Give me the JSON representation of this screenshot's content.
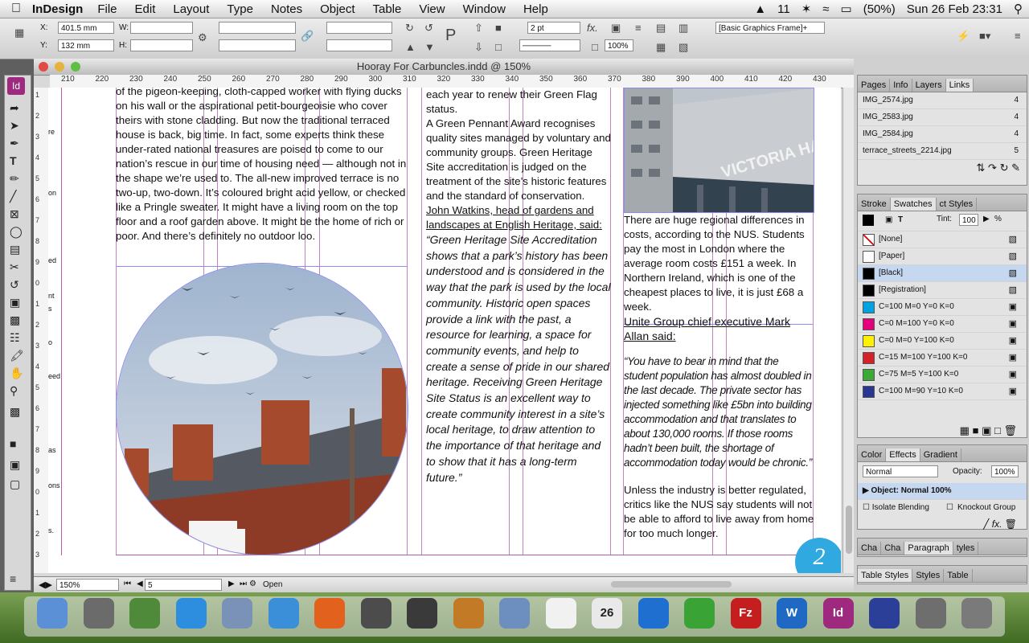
{
  "menubar": {
    "app_name": "InDesign",
    "items": [
      "File",
      "Edit",
      "Layout",
      "Type",
      "Notes",
      "Object",
      "Table",
      "View",
      "Window",
      "Help"
    ],
    "status": {
      "adobe_count": "11",
      "battery": "(50%)",
      "datetime": "Sun 26 Feb  23:31"
    }
  },
  "control": {
    "x_label": "X:",
    "x_value": "401.5 mm",
    "y_label": "Y:",
    "y_value": "132 mm",
    "w_label": "W:",
    "h_label": "H:",
    "stroke_weight": "2 pt",
    "zoom_pct": "100%",
    "object_style": "[Basic Graphics Frame]+"
  },
  "document": {
    "title": "Hooray For Carbuncles.indd @ 150%",
    "ruler_h": [
      "210",
      "220",
      "230",
      "240",
      "250",
      "260",
      "270",
      "280",
      "290",
      "300",
      "310",
      "320",
      "330",
      "340",
      "350",
      "360",
      "370",
      "380",
      "390",
      "400",
      "410",
      "420",
      "430"
    ],
    "ruler_v": [
      "1",
      "2",
      "3",
      "4",
      "5",
      "6",
      "7",
      "8",
      "9",
      "0",
      "1",
      "2",
      "3",
      "4",
      "5",
      "6",
      "7",
      "8",
      "9",
      "0",
      "1",
      "2",
      "3"
    ],
    "page_number_corner": "2",
    "col1_text": "of the pigeon-keeping, cloth-capped worker with flying ducks on his wall or the aspirational petit-bourgeoisie who cover theirs with stone cladding. But now the traditional terraced house is back, big time. In fact, some experts think these under-rated national treasures are poised to come to our nation’s rescue in our time of housing need — although not in the shape we’re used to. The all-new improved terrace is no two-up, two-down. It’s coloured bright acid yellow, or checked like a Pringle sweater. It might have a living room on the top floor and a roof garden above. It might be the home of rich or poor. And there’s definitely no outdoor loo.",
    "col2_p1": "each year to renew their Green Flag status.",
    "col2_p2": "A Green Pennant Award recognises quality sites managed by voluntary and community groups.  Green Heritage Site accreditation is judged on the treatment of the site’s historic features and the standard of conservation.",
    "col2_heading": "John Watkins, head of gardens and landscapes at English Heritage, said:",
    "col2_quote": "“Green Heritage Site Accreditation shows that a park’s history has been understood and is considered in the way that the park is used by the local community. Historic open spaces provide a link with the past, a resource for learning, a space for community events, and help to create a sense of pride in our shared heritage. Receiving Green Heritage Site Status is an excellent way to create community interest in a site’s local heritage, to draw attention to the importance of that heritage and to show that it has a long-term future.”",
    "col3_p1": "There are huge regional differences in costs, according to the NUS. Students pay the most in London where the average room costs £151 a week. In Northern Ireland, which is one of the cheapest places to live, it is just £68 a week.",
    "col3_heading": "Unite Group chief executive Mark Allan said:",
    "col3_quote": "“You have to bear in mind that the student population has almost doubled in the last decade. The private sector has injected something like £5bn into building accommodation and that translates to about 130,000 rooms. If those rooms hadn’t been built, the shortage of accommodation today would be chronic.”",
    "col3_p2": "Unless the industry is better regulated, critics like the NUS say students will not be able to afford to live away from home for too much longer.",
    "building_sign": "VICTORIA HALL",
    "pasteboard_snips": [
      "re",
      "on",
      "ed",
      "nt",
      "s",
      "o",
      "eed",
      "as",
      "ons",
      "s."
    ]
  },
  "statusbar": {
    "zoom": "150%",
    "page": "5",
    "preflight": "Open"
  },
  "links_panel": {
    "tabs": [
      "Pages",
      "Info",
      "Layers",
      "Links"
    ],
    "items": [
      {
        "name": "IMG_2574.jpg",
        "page": "4"
      },
      {
        "name": "IMG_2583.jpg",
        "page": "4"
      },
      {
        "name": "IMG_2584.jpg",
        "page": "4"
      },
      {
        "name": "terrace_streets_2214.jpg",
        "page": "5"
      }
    ]
  },
  "swatches_panel": {
    "tabs": [
      "Stroke",
      "Swatches",
      "ct Styles"
    ],
    "tint_label": "Tint:",
    "tint_value": "100",
    "tint_unit": "%",
    "swatches": [
      {
        "name": "[None]",
        "color": "#ffffff"
      },
      {
        "name": "[Paper]",
        "color": "#ffffff"
      },
      {
        "name": "[Black]",
        "color": "#000000"
      },
      {
        "name": "[Registration]",
        "color": "#000000"
      },
      {
        "name": "C=100 M=0 Y=0 K=0",
        "color": "#00a3e0"
      },
      {
        "name": "C=0 M=100 Y=0 K=0",
        "color": "#e4007c"
      },
      {
        "name": "C=0 M=0 Y=100 K=0",
        "color": "#fff200"
      },
      {
        "name": "C=15 M=100 Y=100 K=0",
        "color": "#d2232a"
      },
      {
        "name": "C=75 M=5 Y=100 K=0",
        "color": "#3aa935"
      },
      {
        "name": "C=100 M=90 Y=10 K=0",
        "color": "#283891"
      }
    ]
  },
  "effects_panel": {
    "tabs": [
      "Color",
      "Effects",
      "Gradient"
    ],
    "blend_mode": "Normal",
    "opacity_label": "Opacity:",
    "opacity_value": "100%",
    "object_line": "Object: Normal 100%",
    "isolate": "Isolate Blending",
    "knockout": "Knockout Group"
  },
  "para_panel": {
    "tabs": [
      "Cha",
      "Cha",
      "Paragraph",
      "tyles"
    ]
  },
  "table_panel": {
    "tabs": [
      "Table Styles",
      "Styles",
      "Table"
    ]
  },
  "dock": {
    "icons": [
      "finder-icon",
      "rocket-icon",
      "preview-icon",
      "appstore-icon",
      "mail-icon",
      "safari-icon",
      "firefox-icon",
      "photobooth-icon",
      "imovie-icon",
      "garageband-icon",
      "iphoto-icon",
      "textedit-icon",
      "calendar-icon",
      "itunes-icon",
      "utorrent-icon",
      "filezilla-icon",
      "word-icon",
      "indesign-icon",
      "photoshop-icon",
      "folder-icon",
      "trash-icon"
    ],
    "calendar_day": "26"
  },
  "colors": {
    "guide": "#b05ab0",
    "accent": "#3875d7",
    "corner_badge": "#2fa9e0"
  }
}
